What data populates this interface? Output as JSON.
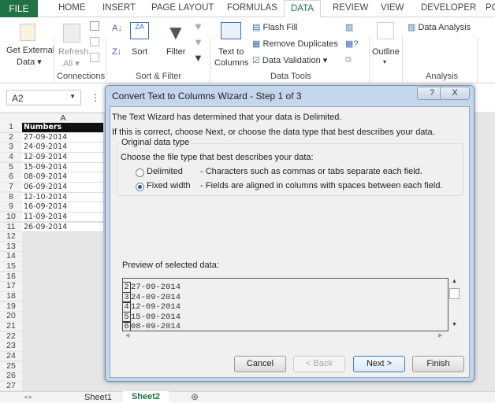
{
  "ribbon_tabs": [
    "FILE",
    "HOME",
    "INSERT",
    "PAGE LAYOUT",
    "FORMULAS",
    "DATA",
    "REVIEW",
    "VIEW",
    "DEVELOPER",
    "PO"
  ],
  "active_tab": "DATA",
  "ribbon": {
    "get_external_1": "Get External",
    "get_external_2": "Data ▾",
    "refresh_1": "Refresh",
    "refresh_2": "All ▾",
    "sort": "Sort",
    "filter": "Filter",
    "text_to_1": "Text to",
    "text_to_2": "Columns",
    "flash_fill": "Flash Fill",
    "remove_duplicates": "Remove Duplicates",
    "data_validation": "Data Validation ▾",
    "outline": "Outline",
    "outline_arrow": "▾",
    "data_analysis": "Data Analysis",
    "groups": {
      "connections": "Connections",
      "sort_filter": "Sort & Filter",
      "data_tools": "Data Tools",
      "analysis": "Analysis"
    }
  },
  "name_box": "A2",
  "sheet": {
    "column": "A",
    "rows": [
      "Numbers",
      "27-09-2014",
      "24-09-2014",
      "12-09-2014",
      "15-09-2014",
      "08-09-2014",
      "06-09-2014",
      "12-10-2014",
      "16-09-2014",
      "11-09-2014",
      "26-09-2014"
    ],
    "row_count": 27
  },
  "sheet_tabs": [
    "Sheet1",
    "Sheet2"
  ],
  "active_sheet": "Sheet2",
  "dialog": {
    "title": "Convert Text to Columns Wizard - Step 1 of 3",
    "help": "?",
    "close": "X",
    "line1": "The Text Wizard has determined that your data is Delimited.",
    "line2": "If this is correct, choose Next, or choose the data type that best describes your data.",
    "group_title": "Original data type",
    "choose": "Choose the file type that best describes your data:",
    "delimited": "Delimited",
    "delimited_desc": "- Characters such as commas or tabs separate each field.",
    "fixed": "Fixed width",
    "fixed_desc": "- Fields are aligned in columns with spaces between each field.",
    "selected": "Fixed width",
    "preview_label": "Preview of selected data:",
    "preview": [
      {
        "n": "2",
        "v": "27-09-2014"
      },
      {
        "n": "3",
        "v": "24-09-2014"
      },
      {
        "n": "4",
        "v": "12-09-2014"
      },
      {
        "n": "5",
        "v": "15-09-2014"
      },
      {
        "n": "6",
        "v": "08-09-2014"
      }
    ],
    "cancel": "Cancel",
    "back": "< Back",
    "next": "Next >",
    "finish": "Finish"
  }
}
